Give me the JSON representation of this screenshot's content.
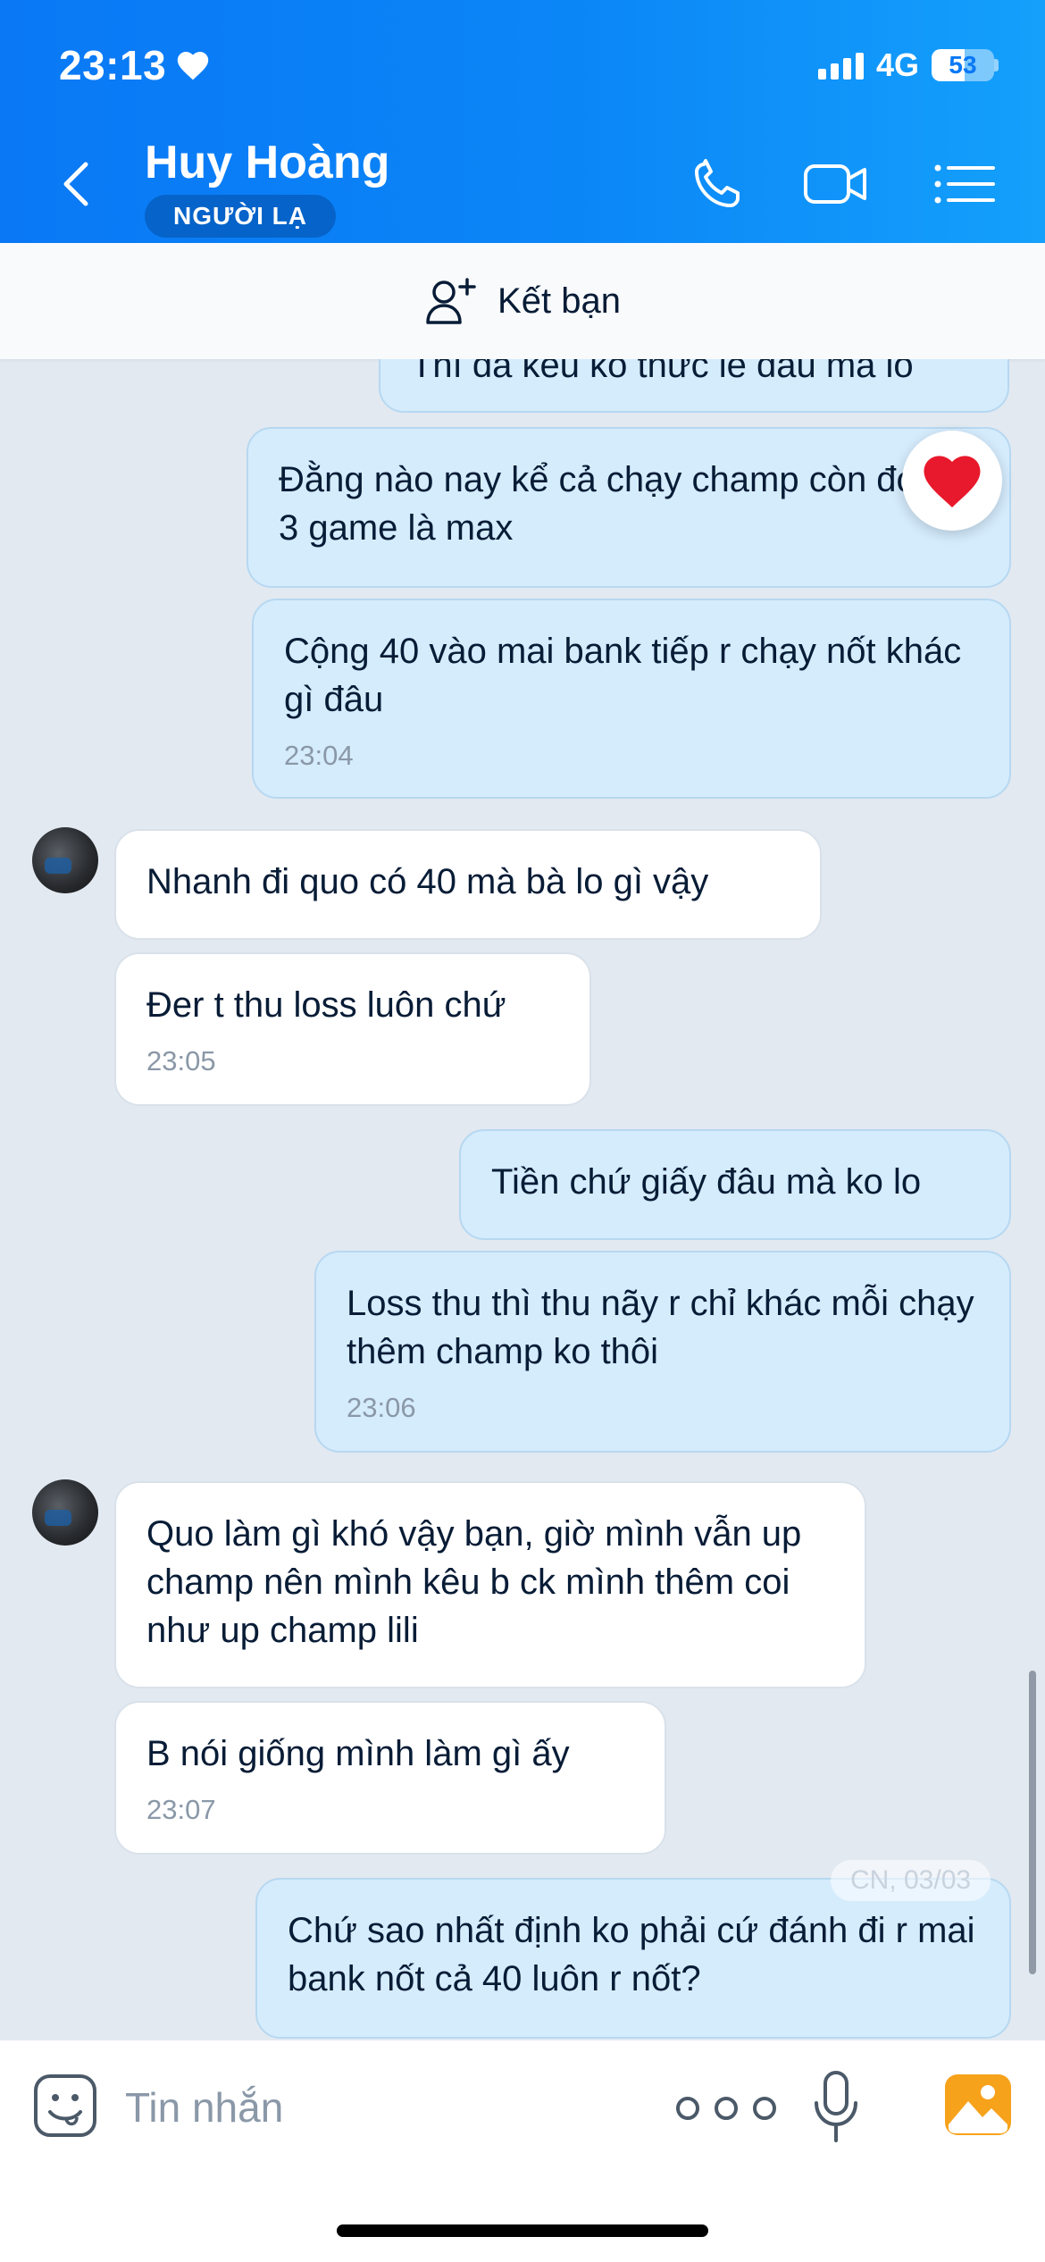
{
  "status_bar": {
    "time": "23:13",
    "network": "4G",
    "battery": "53",
    "battery_level_percent": 53
  },
  "header": {
    "title": "Huy Hoàng",
    "badge": "NGƯỜI LẠ",
    "icons": [
      "back-icon",
      "phone-icon",
      "video-call-icon",
      "menu-list-icon"
    ]
  },
  "add_friend": {
    "label": "Kết bạn",
    "icon": "add-person-icon"
  },
  "messages": [
    {
      "side": "me",
      "text": "Thì đã kêu ko thức lẻ đâu mà lo"
    },
    {
      "side": "me",
      "text": "Đằng nào nay kể cả chạy champ còn đc có 3 game là max",
      "reaction": "heart-icon"
    },
    {
      "side": "me",
      "text": "Cộng 40 vào mai bank tiếp r chạy nốt khác gì đâu",
      "time": "23:04"
    },
    {
      "side": "them",
      "text": "Nhanh đi quo có 40 mà bà lo gì vậy"
    },
    {
      "side": "them",
      "text": "Đer t thu loss luôn chứ",
      "time": "23:05"
    },
    {
      "side": "me",
      "text": "Tiền chứ giấy đâu mà ko lo"
    },
    {
      "side": "me",
      "text": "Loss thu thì thu nãy r chỉ khác mỗi chạy thêm champ ko thôi",
      "time": "23:06"
    },
    {
      "side": "them",
      "text": "Quo làm gì khó vậy bạn, giờ mình vẫn up champ nên mình kêu b ck mình thêm coi như up champ lili"
    },
    {
      "side": "them",
      "text": "B nói giống mình làm gì ấy",
      "time": "23:07"
    },
    {
      "side": "me",
      "text": "Chứ sao nhất định ko phải cứ đánh đi r mai bank nốt cả 40 luôn r nốt?"
    }
  ],
  "date_chip": "CN, 03/03",
  "input_bar": {
    "placeholder": "Tin nhắn",
    "icons": [
      "sticker-icon",
      "more-icon",
      "microphone-icon",
      "image-icon"
    ]
  },
  "colors": {
    "header_gradient_start": "#0a78f5",
    "header_gradient_end": "#14a0fb",
    "my_bubble": "#d5ecfd",
    "their_bubble": "#ffffff",
    "chat_background": "#e2e9f1",
    "badge": "#0563c9"
  }
}
